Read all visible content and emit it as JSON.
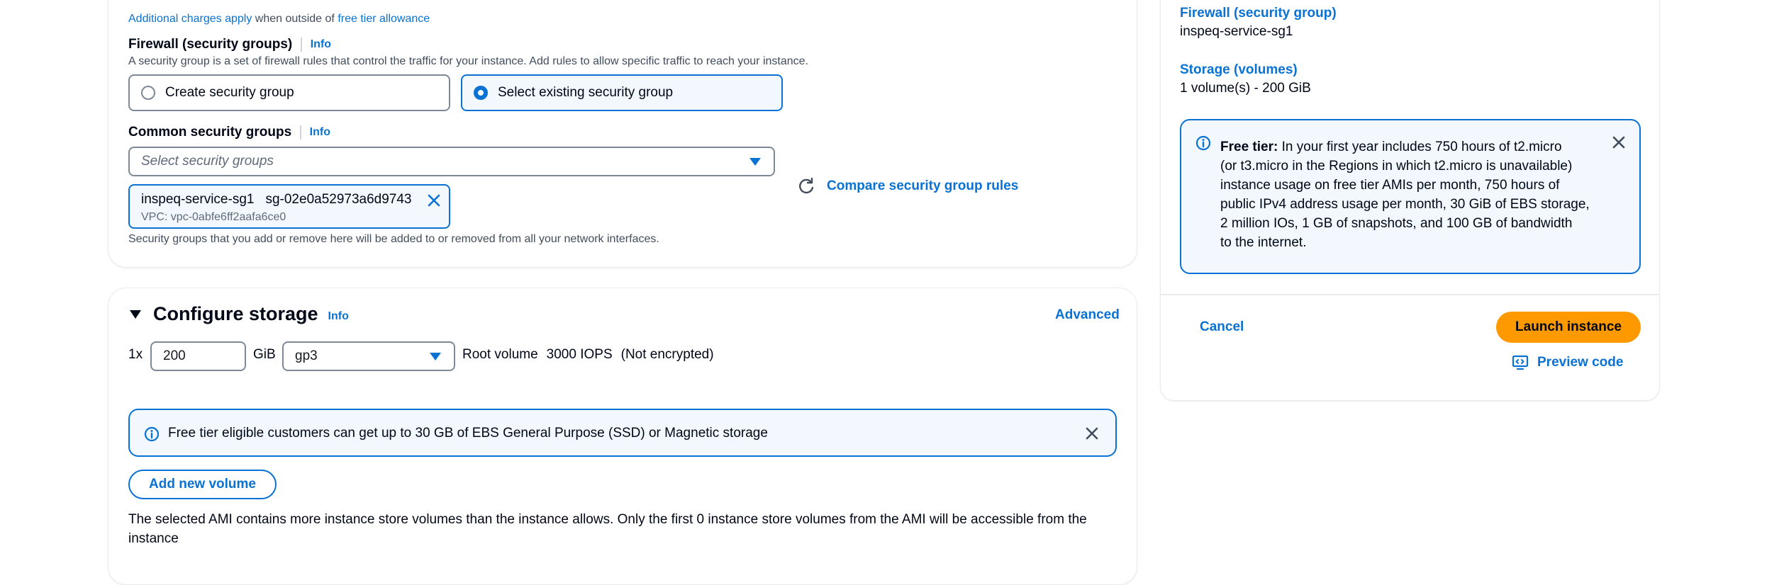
{
  "network": {
    "charges_link": "Additional charges apply",
    "charges_mid": " when outside of ",
    "free_tier_link": "free tier allowance",
    "firewall_label": "Firewall (security groups)",
    "info": "Info",
    "firewall_desc": "A security group is a set of firewall rules that control the traffic for your instance. Add rules to allow specific traffic to reach your instance.",
    "create_sg": "Create security group",
    "select_existing_sg": "Select existing security group",
    "common_sg_label": "Common security groups",
    "select_placeholder": "Select security groups",
    "token_name": "inspeq-service-sg1",
    "token_id": "sg-02e0a52973a6d9743",
    "token_vpc": "VPC: vpc-0abfe6ff2aafa6ce0",
    "compare_rules": "Compare security group rules",
    "sg_note": "Security groups that you add or remove here will be added to or removed from all your network interfaces."
  },
  "storage": {
    "title": "Configure storage",
    "info": "Info",
    "advanced": "Advanced",
    "count": "1x",
    "size_value": "200",
    "unit": "GiB",
    "volume_type": "gp3",
    "root_volume": "Root volume",
    "iops": "3000 IOPS",
    "encryption": "(Not encrypted)",
    "flash_text": "Free tier eligible customers can get up to 30 GB of EBS General Purpose (SSD) or Magnetic storage",
    "add_volume": "Add new volume",
    "ami_note": "The selected AMI contains more instance store volumes than the instance allows. Only the first 0 instance store volumes from the AMI will be accessible from the instance"
  },
  "summary": {
    "firewall_title": "Firewall (security group)",
    "firewall_value": "inspeq-service-sg1",
    "storage_title": "Storage (volumes)",
    "storage_value": "1 volume(s) - 200 GiB",
    "free_tier_bold": "Free tier:",
    "free_tier_lines": [
      " In your first year includes 750 hours of t2.micro",
      "(or t3.micro in the Regions in which t2.micro is unavailable)",
      "instance usage on free tier AMIs per month, 750 hours of",
      "public IPv4 address usage per month, 30 GiB of EBS storage,",
      "2 million IOs, 1 GB of snapshots, and 100 GB of bandwidth",
      "to the internet."
    ],
    "cancel": "Cancel",
    "launch": "Launch instance",
    "preview_code": "Preview code"
  },
  "colors": {
    "link": "#0972d3",
    "primary_button": "#ff9900",
    "info_bg": "#f2f8fd"
  }
}
